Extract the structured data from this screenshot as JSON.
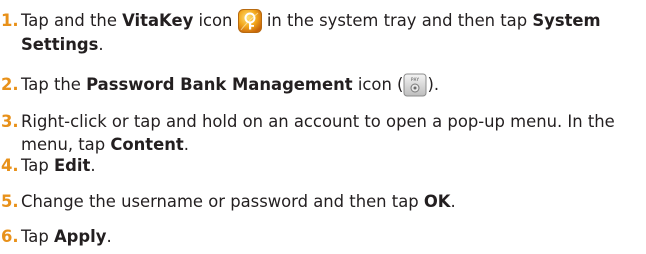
{
  "steps": [
    {
      "number": "1.",
      "parts": {
        "a": "Tap and the ",
        "b": "VitaKey",
        "c": " icon ",
        "d": " in the system tray and then tap ",
        "e": "System Settings",
        "f": "."
      },
      "icon": "vitakey-app-icon"
    },
    {
      "number": "2.",
      "parts": {
        "a": "Tap the ",
        "b": "Password Bank Management",
        "c": " icon (",
        "d": ")."
      },
      "icon": "password-bank-management-icon",
      "icon_label": "PAY"
    },
    {
      "number": "3.",
      "parts": {
        "a": "Right-click or tap and hold on an account to open a pop-up menu. In the menu, tap ",
        "b": "Content",
        "c": "."
      }
    },
    {
      "number": "4.",
      "parts": {
        "a": "Tap ",
        "b": "Edit",
        "c": "."
      }
    },
    {
      "number": "5.",
      "parts": {
        "a": "Change the username or password and then tap ",
        "b": "OK",
        "c": "."
      }
    },
    {
      "number": "6.",
      "parts": {
        "a": "Tap ",
        "b": "Apply",
        "c": "."
      }
    }
  ],
  "colors": {
    "step_number": "#e8911a",
    "body_text": "#231f20"
  }
}
